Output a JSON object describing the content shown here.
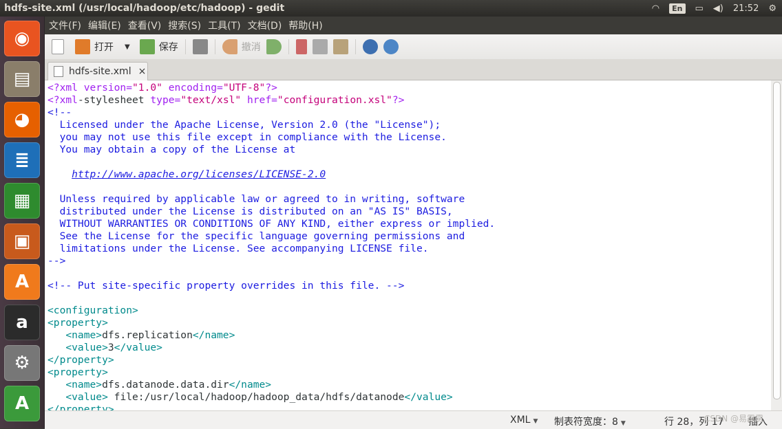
{
  "window_title": "hdfs-site.xml (/usr/local/hadoop/etc/hadoop) - gedit",
  "tray": {
    "language": "En",
    "clock": "21:52"
  },
  "launcher": [
    {
      "name": "ubuntu-dash-icon",
      "glyph": "◉",
      "bg": "#e95420"
    },
    {
      "name": "files-icon",
      "glyph": "▤",
      "bg": "#8a7e6a"
    },
    {
      "name": "firefox-icon",
      "glyph": "◕",
      "bg": "#e66000"
    },
    {
      "name": "writer-icon",
      "glyph": "≣",
      "bg": "#1e6fb8"
    },
    {
      "name": "calc-icon",
      "glyph": "▦",
      "bg": "#2e8b2e"
    },
    {
      "name": "impress-icon",
      "glyph": "▣",
      "bg": "#c85a1c"
    },
    {
      "name": "software-center-icon",
      "glyph": "A",
      "bg": "#f07a1c"
    },
    {
      "name": "amazon-icon",
      "glyph": "a",
      "bg": "#2b2b2b"
    },
    {
      "name": "settings-icon",
      "glyph": "⚙",
      "bg": "#777"
    },
    {
      "name": "updater-icon",
      "glyph": "A",
      "bg": "#3b9a3b"
    }
  ],
  "menubar": [
    "文件(F)",
    "编辑(E)",
    "查看(V)",
    "搜索(S)",
    "工具(T)",
    "文档(D)",
    "帮助(H)"
  ],
  "toolbar": {
    "open_label": "打开",
    "save_label": "保存",
    "undo_label": "撤消"
  },
  "tab": {
    "label": "hdfs-site.xml",
    "close": "×"
  },
  "status": {
    "language": "XML",
    "tab_width": "制表符宽度：8",
    "position": "行 28，列 17",
    "mode": "插入"
  },
  "watermark": "CSDN @易霹雳",
  "code_lines": [
    [
      [
        "pi",
        "<?xml version="
      ],
      [
        "str",
        "\"1.0\""
      ],
      [
        "pi",
        " encoding="
      ],
      [
        "str",
        "\"UTF-8\""
      ],
      [
        "pi",
        "?>"
      ]
    ],
    [
      [
        "pi",
        "<?xml"
      ],
      [
        "plain",
        "-stylesheet "
      ],
      [
        "pi",
        "type="
      ],
      [
        "str",
        "\"text/xsl\""
      ],
      [
        "pi",
        " href="
      ],
      [
        "str",
        "\"configuration.xsl\""
      ],
      [
        "pi",
        "?>"
      ]
    ],
    [
      [
        "cmt",
        "<!--"
      ]
    ],
    [
      [
        "cmt",
        "  Licensed under the Apache License, Version 2.0 (the \"License\");"
      ]
    ],
    [
      [
        "cmt",
        "  you may not use this file except in compliance with the License."
      ]
    ],
    [
      [
        "cmt",
        "  You may obtain a copy of the License at"
      ]
    ],
    [
      [
        "cmt",
        ""
      ]
    ],
    [
      [
        "cmt",
        "    "
      ],
      [
        "url",
        "http://www.apache.org/licenses/LICENSE-2.0"
      ]
    ],
    [
      [
        "cmt",
        ""
      ]
    ],
    [
      [
        "cmt",
        "  Unless required by applicable law or agreed to in writing, software"
      ]
    ],
    [
      [
        "cmt",
        "  distributed under the License is distributed on an \"AS IS\" BASIS,"
      ]
    ],
    [
      [
        "cmt",
        "  WITHOUT WARRANTIES OR CONDITIONS OF ANY KIND, either express or implied."
      ]
    ],
    [
      [
        "cmt",
        "  See the License for the specific language governing permissions and"
      ]
    ],
    [
      [
        "cmt",
        "  limitations under the License. See accompanying LICENSE file."
      ]
    ],
    [
      [
        "cmt",
        "-->"
      ]
    ],
    [
      [
        "plain",
        ""
      ]
    ],
    [
      [
        "cmt",
        "<!-- Put site-specific property overrides in this file. -->"
      ]
    ],
    [
      [
        "plain",
        ""
      ]
    ],
    [
      [
        "tag",
        "<configuration>"
      ]
    ],
    [
      [
        "tag",
        "<property>"
      ]
    ],
    [
      [
        "plain",
        "   "
      ],
      [
        "tag",
        "<name>"
      ],
      [
        "plain",
        "dfs.replication"
      ],
      [
        "tag",
        "</name>"
      ]
    ],
    [
      [
        "plain",
        "   "
      ],
      [
        "tag",
        "<value>"
      ],
      [
        "plain",
        "3"
      ],
      [
        "tag",
        "</value>"
      ]
    ],
    [
      [
        "tag",
        "</property>"
      ]
    ],
    [
      [
        "tag",
        "<property>"
      ]
    ],
    [
      [
        "plain",
        "   "
      ],
      [
        "tag",
        "<name>"
      ],
      [
        "plain",
        "dfs.datanode.data.dir"
      ],
      [
        "tag",
        "</name>"
      ]
    ],
    [
      [
        "plain",
        "   "
      ],
      [
        "tag",
        "<value>"
      ],
      [
        "plain",
        " file:/usr/local/hadoop/hadoop_data/hdfs/datanode"
      ],
      [
        "tag",
        "</value>"
      ]
    ],
    [
      [
        "tag",
        "</property>"
      ]
    ]
  ]
}
